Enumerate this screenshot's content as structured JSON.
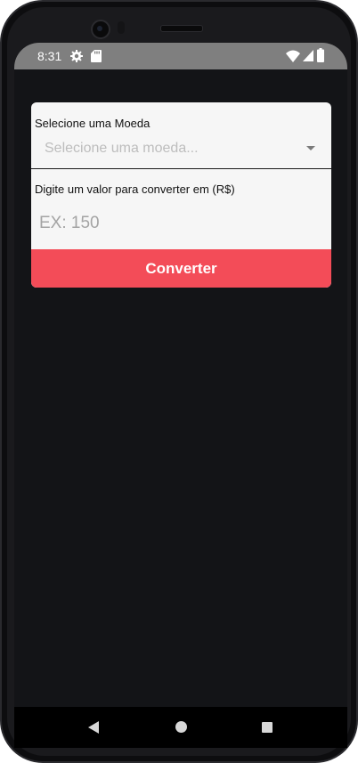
{
  "status_bar": {
    "time": "8:31",
    "icons": [
      "gear-icon",
      "sd-card-icon",
      "wifi-icon",
      "signal-icon",
      "battery-icon"
    ]
  },
  "form": {
    "currency_label": "Selecione uma Moeda",
    "currency_placeholder": "Selecione uma moeda...",
    "value_label": "Digite um valor para converter em (R$)",
    "value_placeholder": "EX: 150",
    "value": "",
    "convert_label": "Converter"
  },
  "nav_bar": {
    "icons": [
      "back-icon",
      "home-icon",
      "recents-icon"
    ]
  },
  "colors": {
    "accent": "#f34c58",
    "background": "#131417",
    "card": "#f6f6f6",
    "status_bar": "#7f7f7f"
  }
}
